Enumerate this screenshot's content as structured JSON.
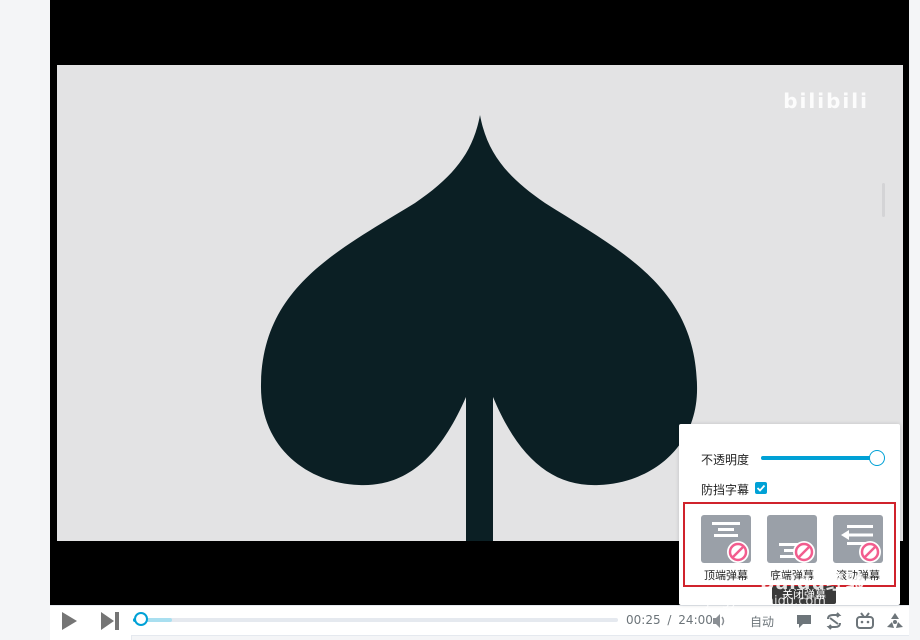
{
  "video": {
    "watermark": "bilibili",
    "colors": {
      "background": "#e3e3e4",
      "spade": "#0b1f24",
      "letterbox": "#000000"
    }
  },
  "controls": {
    "icons": [
      "play-icon",
      "next-icon",
      "volume-icon",
      "danmaku-icon",
      "loop-icon",
      "bilibili-tv-icon",
      "radiation-icon"
    ],
    "progress": {
      "played_fraction": 0.017,
      "buffered_fraction": 0.08
    },
    "current_time": "00:25",
    "separator": "/",
    "duration": "24:00",
    "quality": "自动",
    "accent_color": "#00a1d6"
  },
  "danmaku_panel": {
    "opacity_label": "不透明度",
    "opacity_value": 1.0,
    "block_subtitle_label": "防挡字幕",
    "block_subtitle_checked": true,
    "buttons": [
      {
        "label": "顶端弹幕",
        "icon": "top-danmaku-icon",
        "disabled_icon": "ban-icon"
      },
      {
        "label": "底端弹幕",
        "icon": "bottom-danmaku-icon",
        "disabled_icon": "ban-icon"
      },
      {
        "label": "滚动弹幕",
        "icon": "scroll-danmaku-icon",
        "disabled_icon": "ban-icon"
      }
    ],
    "highlight_color": "#d0232c",
    "ban_color": "#f25d8e"
  },
  "tooltip": {
    "text": "关闭弹幕"
  },
  "overlay_watermark": {
    "brand": "Baidu经验",
    "url": "jingyan.baidu.com"
  }
}
